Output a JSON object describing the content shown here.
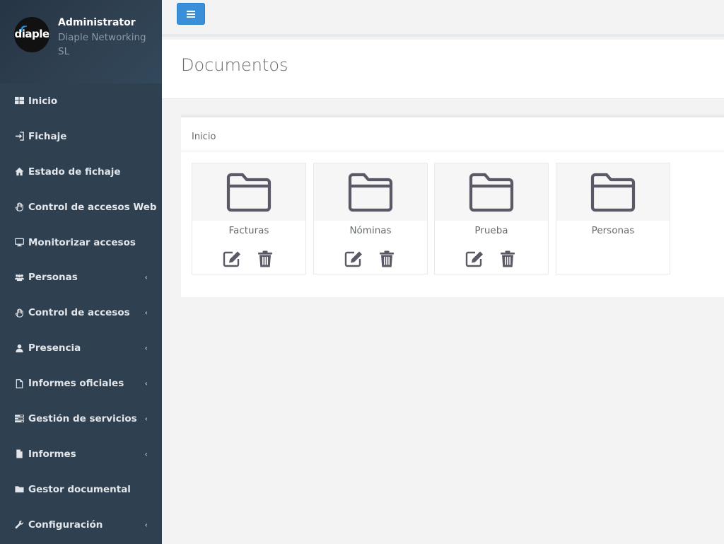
{
  "profile": {
    "logo_text": "diaple",
    "name": "Administrator",
    "company": "Diaple Networking SL"
  },
  "sidebar": {
    "items": [
      {
        "label": "Inicio",
        "icon": "th-large-icon",
        "has_submenu": false
      },
      {
        "label": "Fichaje",
        "icon": "sign-in-icon",
        "has_submenu": false
      },
      {
        "label": "Estado de fichaje",
        "icon": "home-icon",
        "has_submenu": false
      },
      {
        "label": "Control de accesos Web",
        "icon": "hand-icon",
        "has_submenu": false
      },
      {
        "label": "Monitorizar accesos",
        "icon": "desktop-icon",
        "has_submenu": false
      },
      {
        "label": "Personas",
        "icon": "users-icon",
        "has_submenu": true
      },
      {
        "label": "Control de accesos",
        "icon": "hand-icon",
        "has_submenu": true
      },
      {
        "label": "Presencia",
        "icon": "user-icon",
        "has_submenu": true
      },
      {
        "label": "Informes oficiales",
        "icon": "file-o-icon",
        "has_submenu": true
      },
      {
        "label": "Gestión de servicios",
        "icon": "tasks-icon",
        "has_submenu": true
      },
      {
        "label": "Informes",
        "icon": "file-icon",
        "has_submenu": true
      },
      {
        "label": "Gestor documental",
        "icon": "folder-icon",
        "has_submenu": false
      },
      {
        "label": "Configuración",
        "icon": "wrench-icon",
        "has_submenu": true
      }
    ],
    "chevron": "‹"
  },
  "page": {
    "title": "Documentos",
    "breadcrumb": "Inicio"
  },
  "folders": [
    {
      "name": "Facturas",
      "editable": true
    },
    {
      "name": "Nóminas",
      "editable": true
    },
    {
      "name": "Prueba",
      "editable": true
    },
    {
      "name": "Personas",
      "editable": false
    }
  ],
  "colors": {
    "sidebar_bg": "#2f4050",
    "accent_button": "#3a90d8",
    "folder_icon": "#5b5966"
  }
}
